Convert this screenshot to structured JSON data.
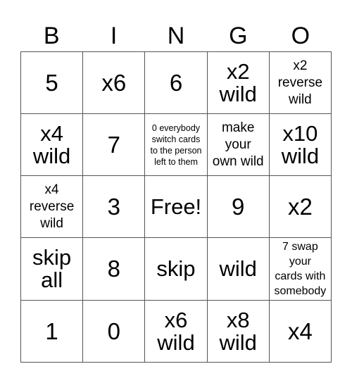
{
  "header": {
    "letters": [
      "B",
      "I",
      "N",
      "G",
      "O"
    ]
  },
  "grid": {
    "cells": [
      [
        "5",
        "x6",
        "6",
        "x2\nwild",
        "x2\nreverse\nwild"
      ],
      [
        "x4\nwild",
        "7",
        "0 everybody\nswitch cards\nto the person\nleft to them",
        "make\nyour\nown wild",
        "x10\nwild"
      ],
      [
        "x4\nreverse\nwild",
        "3",
        "Free!",
        "9",
        "x2"
      ],
      [
        "skip\nall",
        "8",
        "skip",
        "wild",
        "7 swap\nyour\ncards with\nsomebody"
      ],
      [
        "1",
        "0",
        "x6\nwild",
        "x8\nwild",
        "x4"
      ]
    ]
  }
}
